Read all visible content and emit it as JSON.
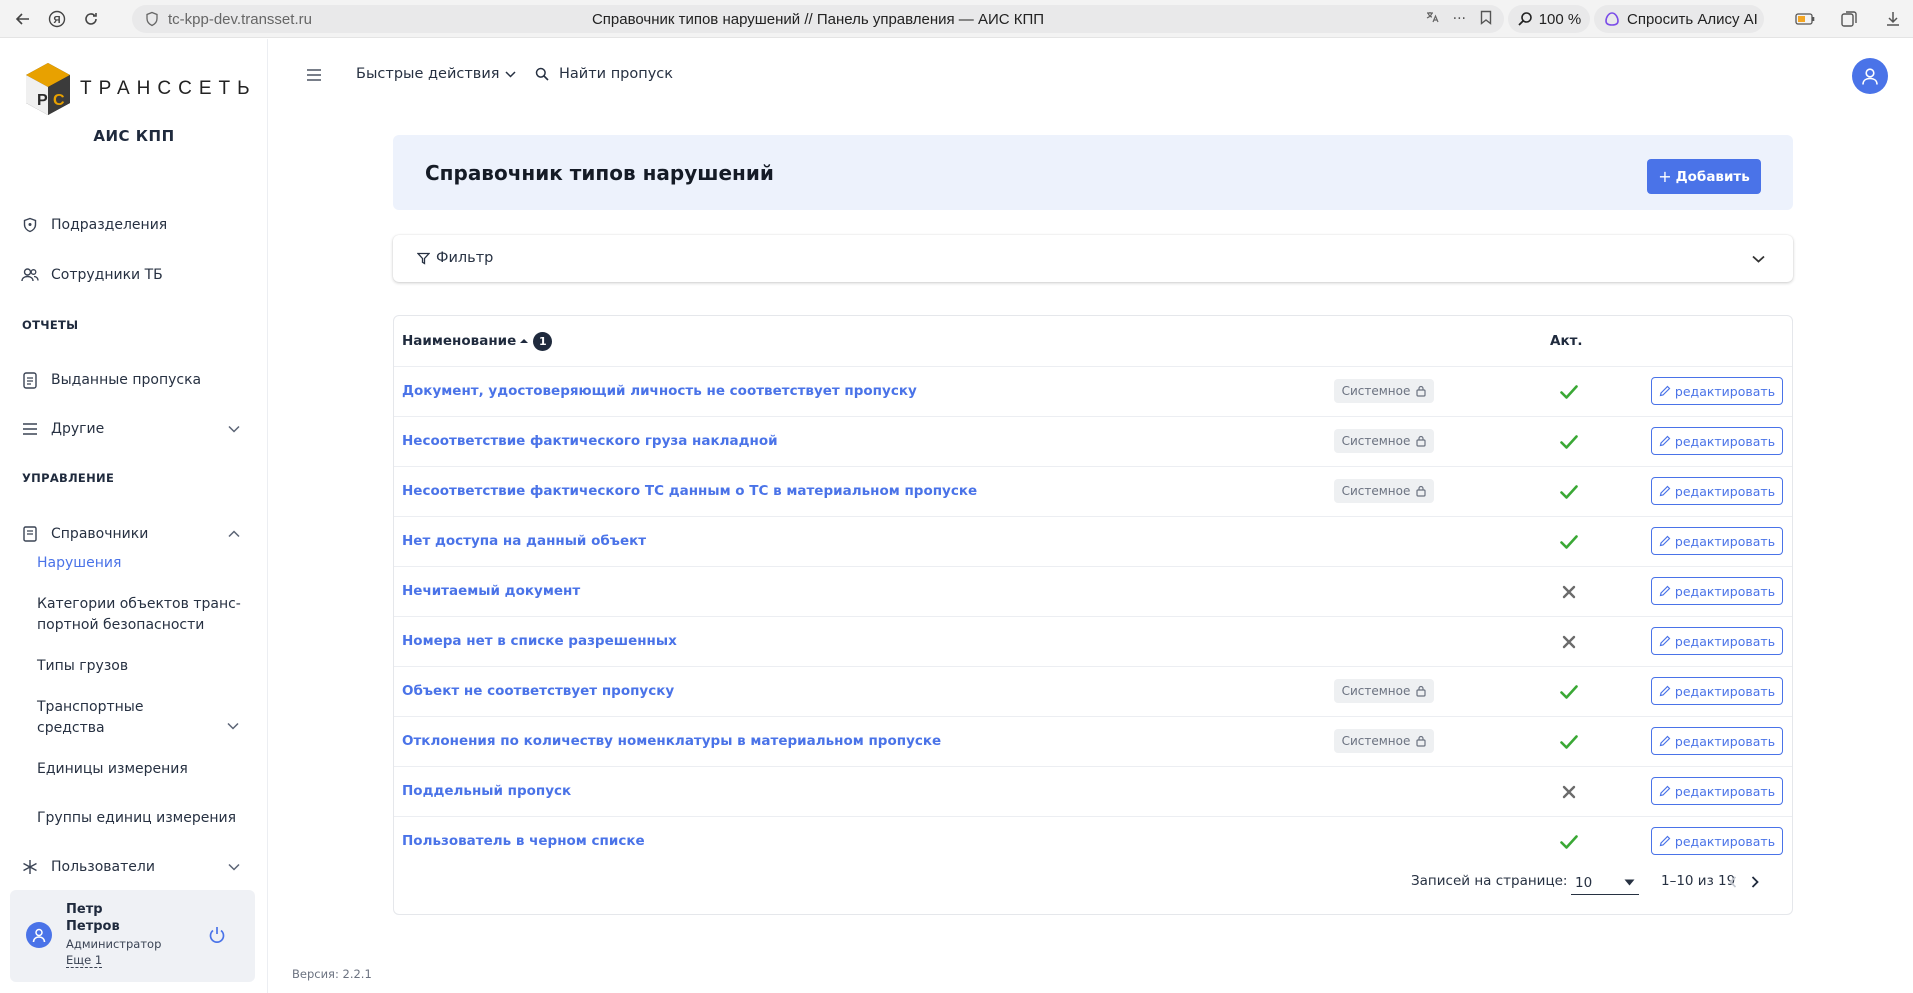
{
  "browser": {
    "url": "tc-kpp-dev.transset.ru",
    "tab_title": "Справочник типов нарушений // Панель управления — АИС КПП",
    "zoom": "100 %",
    "alice_label": "Спросить Алису AI"
  },
  "sidebar": {
    "logo_text": "ТРАНССЕТЬ",
    "app_name": "АИС КПП",
    "items": [
      {
        "label": "Подразделения",
        "icon": "shield-icon"
      },
      {
        "label": "Сотрудники ТБ",
        "icon": "users-icon"
      }
    ],
    "section_reports": "ОТЧЕТЫ",
    "reports": [
      {
        "label": "Выданные пропуска",
        "icon": "document-icon"
      },
      {
        "label": "Другие",
        "icon": "list-icon"
      }
    ],
    "section_manage": "УПРАВЛЕНИЕ",
    "directories": {
      "label": "Справочники",
      "icon": "book-icon"
    },
    "sub_items": [
      {
        "label": "Нарушения",
        "active": true
      },
      {
        "label": "Категории объектов транс-портной безопасности"
      },
      {
        "label": "Типы грузов"
      },
      {
        "label": "Транспортные средства"
      },
      {
        "label": "Единицы измерения"
      },
      {
        "label": "Группы единиц измерения"
      }
    ],
    "users": {
      "label": "Пользователи",
      "icon": "asterisk-icon"
    }
  },
  "user": {
    "first_name": "Петр",
    "last_name": "Петров",
    "role": "Администратор",
    "more": "Еще 1"
  },
  "topbar": {
    "quick_actions": "Быстрые действия",
    "find_pass": "Найти пропуск"
  },
  "page": {
    "title": "Справочник типов нарушений",
    "add_button": "Добавить",
    "filter_label": "Фильтр"
  },
  "table": {
    "col_name": "Наименование",
    "sort_index": "1",
    "col_active": "Акт.",
    "system_label": "Системное",
    "edit_label": "редактировать",
    "rows": [
      {
        "name": "Документ, удостоверяющий личность не соответствует пропуску",
        "system": true,
        "active": true
      },
      {
        "name": "Несоответствие фактического груза накладной",
        "system": true,
        "active": true
      },
      {
        "name": "Несоответствие фактического ТС данным о ТС в материальном пропуске",
        "system": true,
        "active": true
      },
      {
        "name": "Нет доступа на данный объект",
        "system": false,
        "active": true
      },
      {
        "name": "Нечитаемый документ",
        "system": false,
        "active": false
      },
      {
        "name": "Номера нет в списке разрешенных",
        "system": false,
        "active": false
      },
      {
        "name": "Объект не соответствует пропуску",
        "system": true,
        "active": true
      },
      {
        "name": "Отклонения по количеству номенклатуры в материальном пропуске",
        "system": true,
        "active": true
      },
      {
        "name": "Поддельный пропуск",
        "system": false,
        "active": false
      },
      {
        "name": "Пользователь в черном списке",
        "system": false,
        "active": true
      }
    ],
    "pager": {
      "per_page_label": "Записей на странице:",
      "per_page_value": "10",
      "range": "1–10 из 19"
    }
  },
  "version": "Версия: 2.2.1",
  "colors": {
    "accent": "#4a73e8",
    "active_check": "#3aa835",
    "inactive_cross": "#6b6b6b",
    "header_bg": "#edf2fc"
  }
}
